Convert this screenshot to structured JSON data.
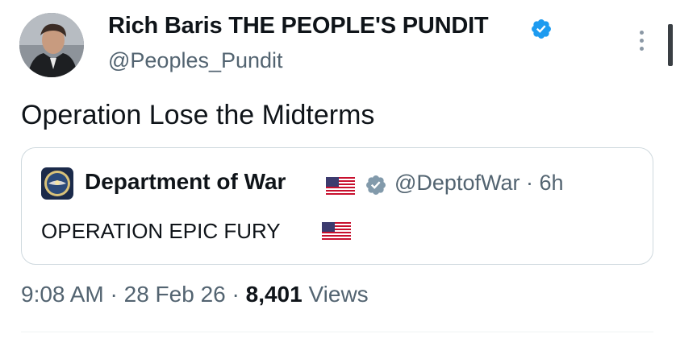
{
  "author": {
    "name": "Rich Baris THE PEOPLE'S PUNDIT",
    "handle": "@Peoples_Pundit",
    "verified_icon": "blue-verified-badge-icon"
  },
  "tweet": {
    "text": "Operation Lose the Midterms"
  },
  "quoted_tweet": {
    "name": "Department of War",
    "flag_icon": "us-flag-emoji",
    "verified_icon": "gray-verified-badge-icon",
    "meta": "@DeptofWar · 6h",
    "text": "OPERATION EPIC FURY"
  },
  "meta": {
    "time": "9:08 AM",
    "separator": " · ",
    "date": "28 Feb 26",
    "views_count": "8,401",
    "views_label": " Views"
  },
  "colors": {
    "text": "#0f1419",
    "secondary": "#536471",
    "verified_blue": "#1d9bf0",
    "border": "#cfd9de"
  }
}
